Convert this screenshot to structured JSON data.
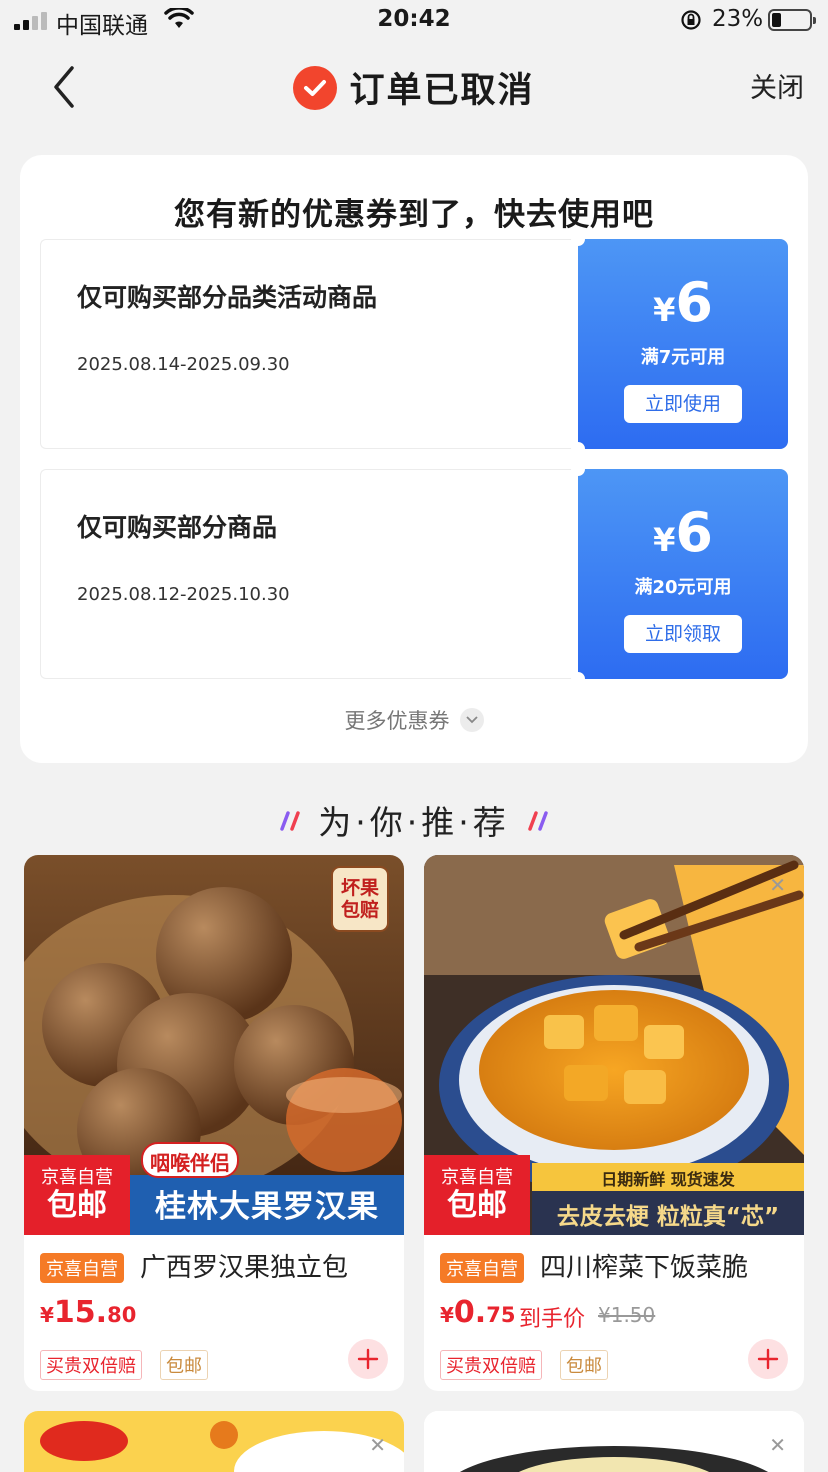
{
  "status_bar": {
    "carrier": "中国联通",
    "time": "20:42",
    "battery_percent": "23%"
  },
  "nav": {
    "title": "订单已取消",
    "close_label": "关闭"
  },
  "coupon_panel": {
    "heading": "您有新的优惠券到了，快去使用吧",
    "coupons": [
      {
        "description": "仅可购买部分品类活动商品",
        "dates": "2025.08.14-2025.09.30",
        "currency": "¥",
        "amount": "6",
        "threshold": "满7元可用",
        "button": "立即使用"
      },
      {
        "description": "仅可购买部分商品",
        "dates": "2025.08.12-2025.10.30",
        "currency": "¥",
        "amount": "6",
        "threshold": "满20元可用",
        "button": "立即领取"
      }
    ],
    "more_label": "更多优惠券"
  },
  "recommend": {
    "title": "为·你·推·荐",
    "products": [
      {
        "image_badge": "坏果包赔",
        "image_tag": "咽喉伴侣",
        "image_banner": "桂林大果罗汉果",
        "image_label_top": "京喜自营",
        "image_label_bottom": "包邮",
        "shop_tag": "京喜自营",
        "name": "广西罗汉果独立包",
        "price_currency": "¥",
        "price_int": "15.",
        "price_dec": "80",
        "badges": [
          "买贵双倍赔",
          "包邮"
        ]
      },
      {
        "image_ribbon": "日期新鲜 现货速发",
        "image_banner": "去皮去梗 粒粒真“芯”",
        "image_label_top": "京喜自营",
        "image_label_bottom": "包邮",
        "shop_tag": "京喜自营",
        "name": "四川榨菜下饭菜脆",
        "price_currency": "¥",
        "price_int": "0.",
        "price_dec": "75",
        "price_note": "到手价",
        "orig_price": "¥1.50",
        "badges": [
          "买贵双倍赔",
          "包邮"
        ]
      }
    ]
  },
  "colors": {
    "accent_red": "#e8242e",
    "coupon_blue": "#2d6cf1",
    "tag_orange": "#f57a26"
  }
}
